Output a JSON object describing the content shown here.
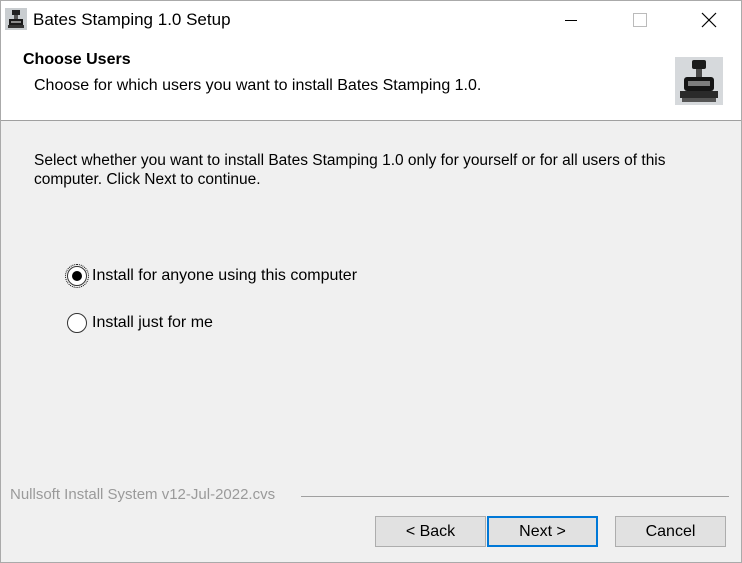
{
  "window": {
    "title": "Bates Stamping 1.0 Setup",
    "controls": {
      "minimize": "minimize-icon",
      "maximize": "maximize-icon",
      "close": "close-icon"
    }
  },
  "header": {
    "title": "Choose Users",
    "subtitle": "Choose for which users you want to install Bates Stamping 1.0.",
    "image": "stamp-machine-icon"
  },
  "body": {
    "instructions": "Select whether you want to install Bates Stamping 1.0 only for yourself or for all users of this computer. Click Next to continue.",
    "options": [
      {
        "label": "Install for anyone using this computer",
        "selected": true
      },
      {
        "label": "Install just for me",
        "selected": false
      }
    ]
  },
  "branding": "Nullsoft Install System v12-Jul-2022.cvs",
  "buttons": {
    "back": "< Back",
    "next": "Next >",
    "cancel": "Cancel"
  },
  "colors": {
    "accent": "#0078d7",
    "dialog_bg": "#f0f0f0"
  }
}
